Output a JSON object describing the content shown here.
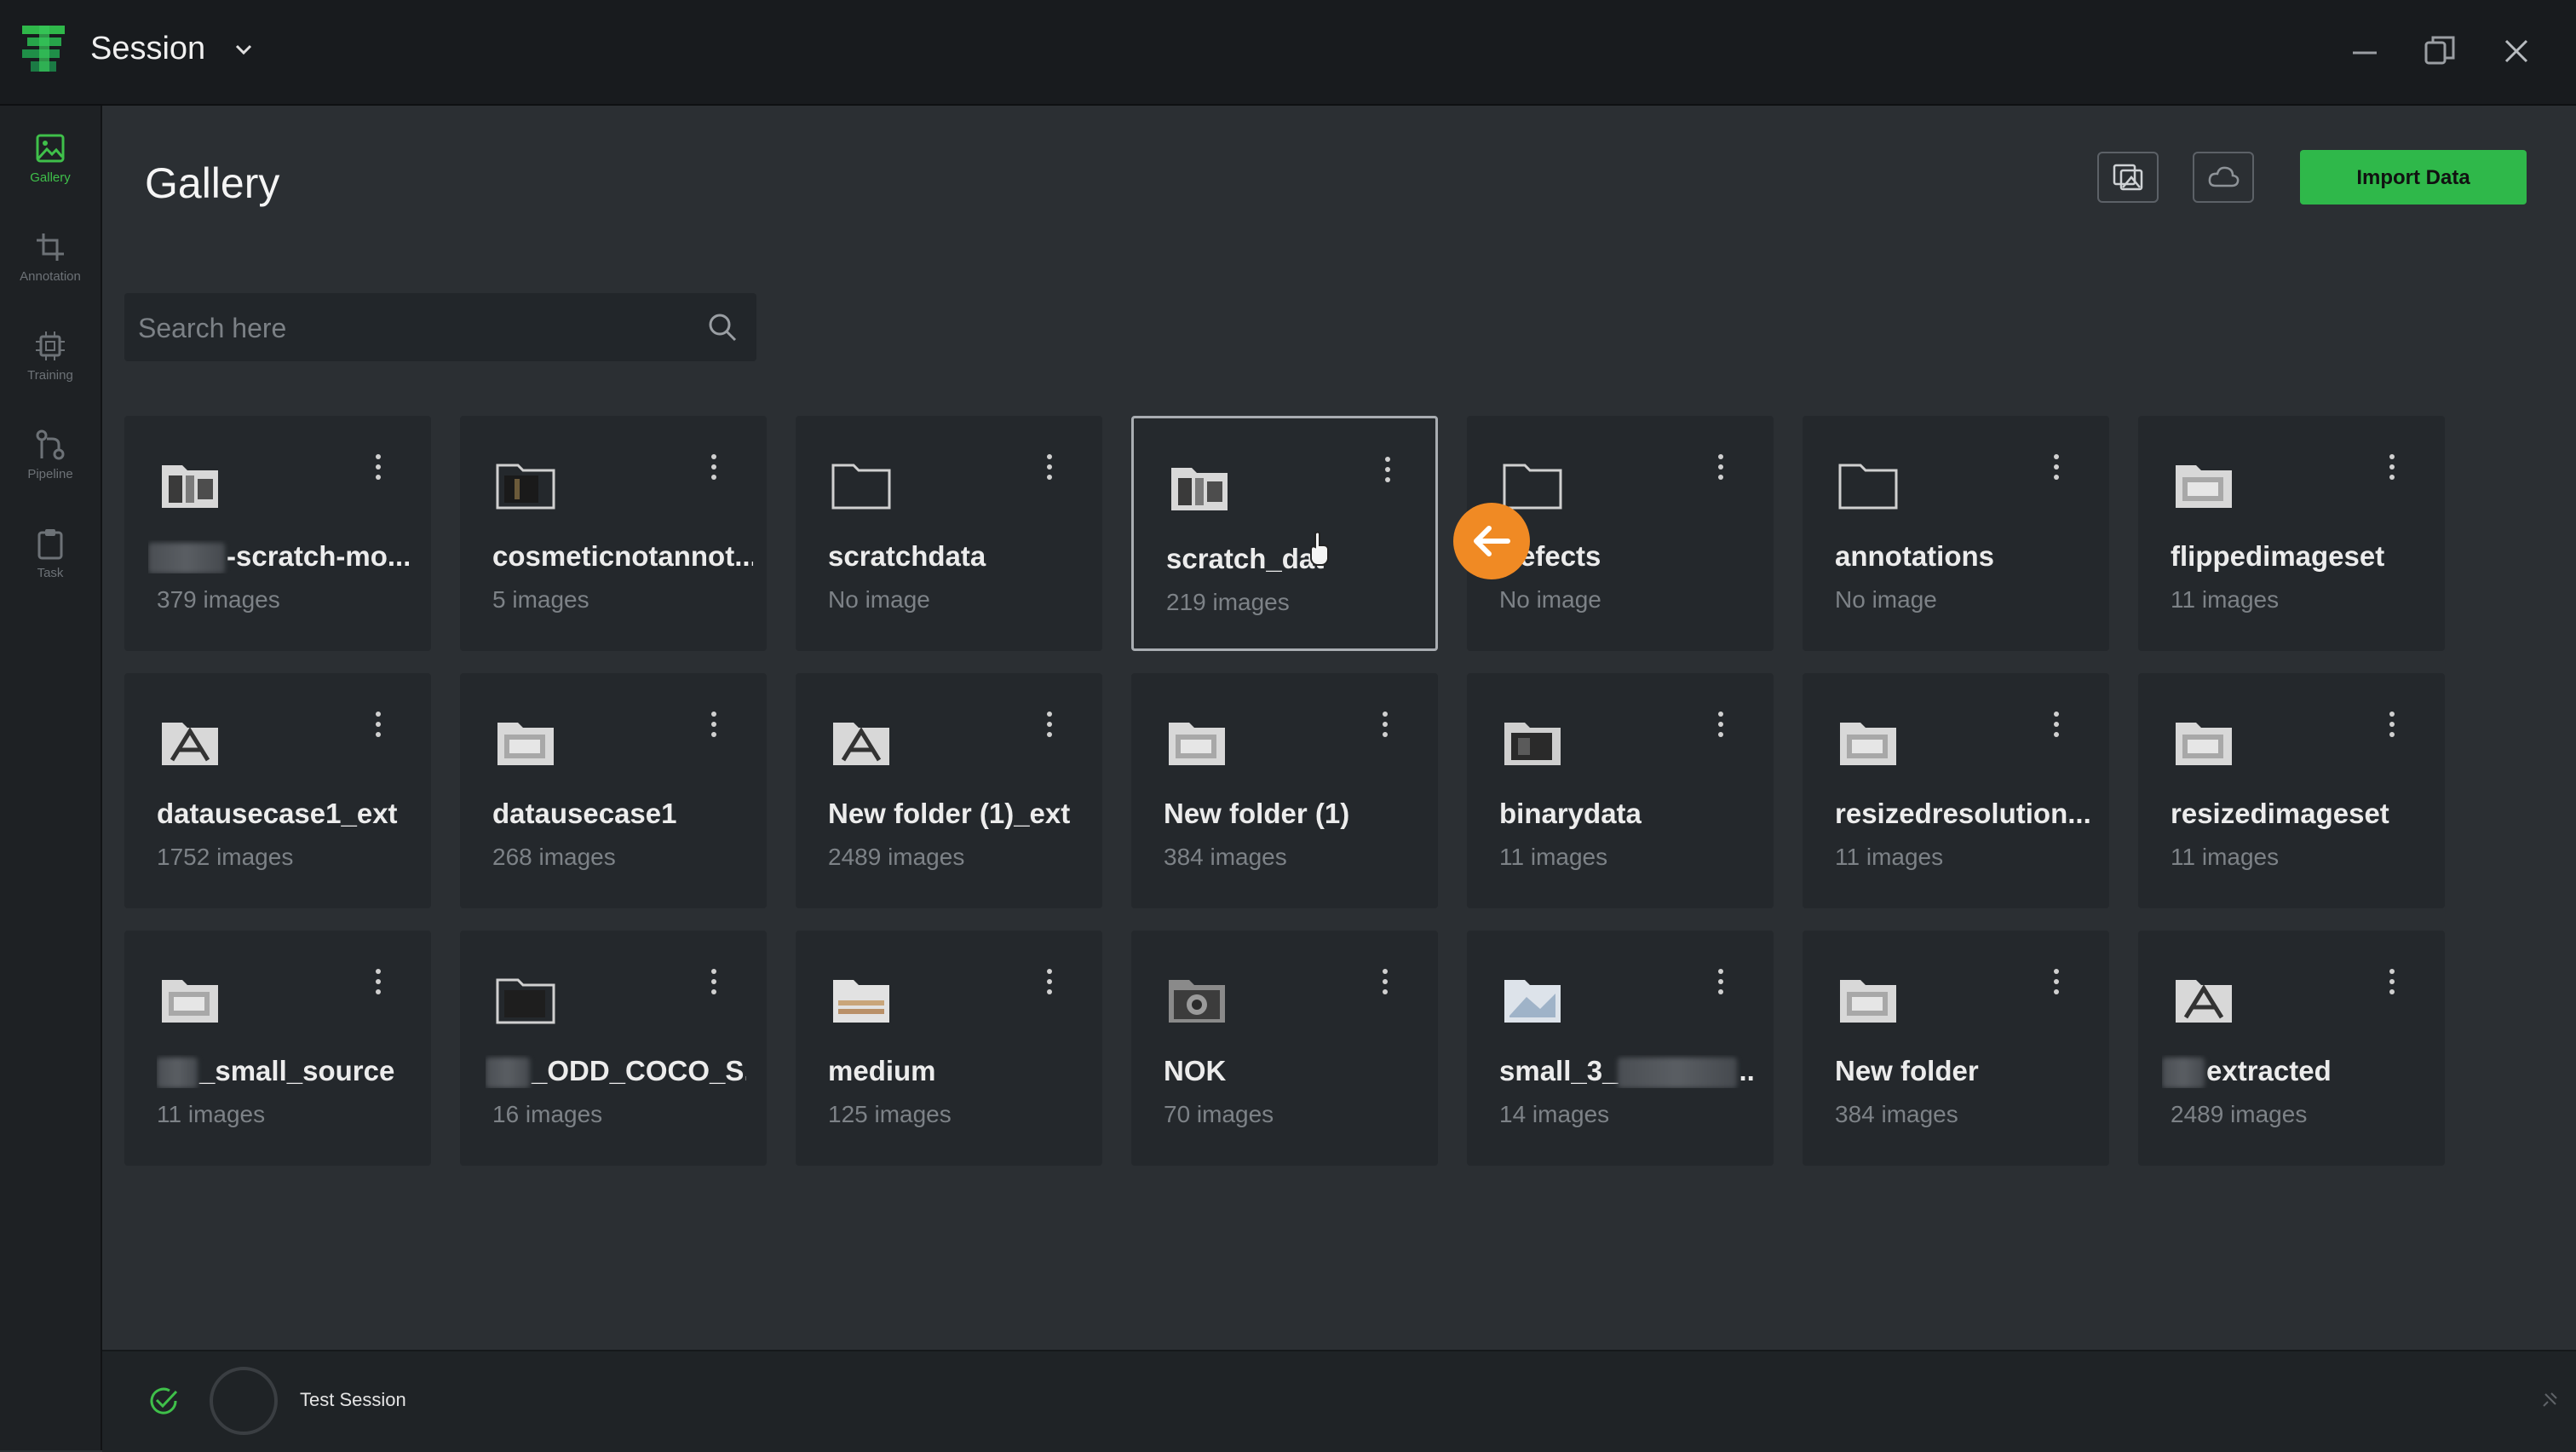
{
  "window": {
    "session_label": "Session"
  },
  "sidebar": {
    "items": [
      {
        "label": "Gallery",
        "icon": "image-icon",
        "active": true
      },
      {
        "label": "Annotation",
        "icon": "crop-icon",
        "active": false
      },
      {
        "label": "Training",
        "icon": "chip-icon",
        "active": false
      },
      {
        "label": "Pipeline",
        "icon": "pipeline-icon",
        "active": false
      },
      {
        "label": "Task",
        "icon": "clipboard-icon",
        "active": false
      }
    ]
  },
  "header": {
    "title": "Gallery",
    "tools": [
      "image-stack-icon",
      "cloud-icon"
    ],
    "import_label": "Import Data"
  },
  "search": {
    "placeholder": "Search here",
    "value": ""
  },
  "cards": [
    {
      "name": "-scratch-mo...",
      "count": "379 images",
      "icon": "folder-images-icon"
    },
    {
      "name": "cosmeticnotannot...",
      "count": "5 images",
      "icon": "folder-dark-icon"
    },
    {
      "name": "scratchdata",
      "count": "No image",
      "icon": "folder-empty-icon"
    },
    {
      "name": "scratch_dat",
      "count": "219 images",
      "icon": "folder-images-icon",
      "selected": true
    },
    {
      "name": "efects",
      "count": "No image",
      "icon": "folder-empty-icon"
    },
    {
      "name": "annotations",
      "count": "No image",
      "icon": "folder-empty-icon"
    },
    {
      "name": "flippedimageset",
      "count": "11 images",
      "icon": "folder-images-icon"
    },
    {
      "name": "datausecase1_ext",
      "count": "1752 images",
      "icon": "folder-a-icon"
    },
    {
      "name": "datausecase1",
      "count": "268 images",
      "icon": "folder-images-icon"
    },
    {
      "name": "New folder (1)_ext",
      "count": "2489 images",
      "icon": "folder-a-icon"
    },
    {
      "name": "New folder (1)",
      "count": "384 images",
      "icon": "folder-images-icon"
    },
    {
      "name": "binarydata",
      "count": "11 images",
      "icon": "folder-dark-icon"
    },
    {
      "name": "resizedresolution...",
      "count": "11 images",
      "icon": "folder-images-icon"
    },
    {
      "name": "resizedimageset",
      "count": "11 images",
      "icon": "folder-images-icon"
    },
    {
      "name": "_small_source",
      "count": "11 images",
      "icon": "folder-images-icon"
    },
    {
      "name": "_ODD_COCO_S...",
      "count": "16 images",
      "icon": "folder-dark-icon"
    },
    {
      "name": "medium",
      "count": "125 images",
      "icon": "folder-images-icon"
    },
    {
      "name": "NOK",
      "count": "70 images",
      "icon": "folder-camera-icon"
    },
    {
      "name": "small_3_",
      "count": "14 images",
      "icon": "folder-images-icon"
    },
    {
      "name": "New folder",
      "count": "384 images",
      "icon": "folder-images-icon"
    },
    {
      "name": "extracted",
      "count": "2489 images",
      "icon": "folder-a-icon"
    }
  ],
  "status": {
    "session_name": "Test Session"
  },
  "colors": {
    "accent": "#2fb84a",
    "back_arrow": "#f08a24",
    "background": "#2b2f33"
  }
}
